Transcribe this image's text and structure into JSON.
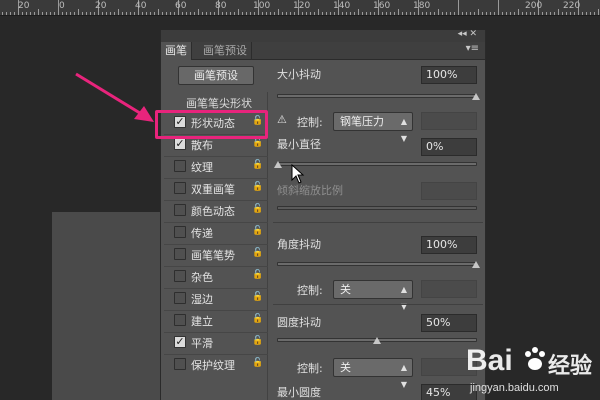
{
  "ruler": {
    "labels": [
      "20",
      "0",
      "20",
      "40",
      "60",
      "80",
      "100",
      "120",
      "140",
      "160",
      "180",
      "200",
      "220"
    ]
  },
  "panel": {
    "tabs": [
      {
        "label": "画笔",
        "active": true
      },
      {
        "label": "画笔预设",
        "active": false
      }
    ],
    "preset_button": "画笔预设",
    "brush_tip_shape": "画笔笔尖形状",
    "items": [
      {
        "label": "形状动态",
        "checked": true
      },
      {
        "label": "散布",
        "checked": true
      },
      {
        "label": "纹理",
        "checked": false
      },
      {
        "label": "双重画笔",
        "checked": false
      },
      {
        "label": "颜色动态",
        "checked": false
      },
      {
        "label": "传递",
        "checked": false
      },
      {
        "label": "画笔笔势",
        "checked": false
      },
      {
        "label": "杂色",
        "checked": false
      },
      {
        "label": "湿边",
        "checked": false
      },
      {
        "label": "建立",
        "checked": false
      },
      {
        "label": "平滑",
        "checked": true
      },
      {
        "label": "保护纹理",
        "checked": false
      }
    ],
    "size_jitter": {
      "label": "大小抖动",
      "value": "100%",
      "level": 1.0
    },
    "control1": {
      "label": "控制:",
      "value": "钢笔压力"
    },
    "min_diameter": {
      "label": "最小直径",
      "value": "0%",
      "level": 0.0
    },
    "tilt_scale": {
      "label": "倾斜缩放比例"
    },
    "angle_jitter": {
      "label": "角度抖动",
      "value": "100%",
      "level": 1.0
    },
    "control2": {
      "label": "控制:",
      "value": "关"
    },
    "roundness_jitter": {
      "label": "圆度抖动",
      "value": "50%",
      "level": 0.5
    },
    "control3": {
      "label": "控制:",
      "value": "关"
    },
    "min_roundness": {
      "label": "最小圆度",
      "value": "45%"
    }
  },
  "watermark": {
    "brand": "Bai",
    "brand2": "经验",
    "url": "jingyan.baidu.com"
  },
  "colors": {
    "highlight": "#e8247c",
    "panel_bg": "#535353",
    "canvas_bg": "#282828"
  }
}
